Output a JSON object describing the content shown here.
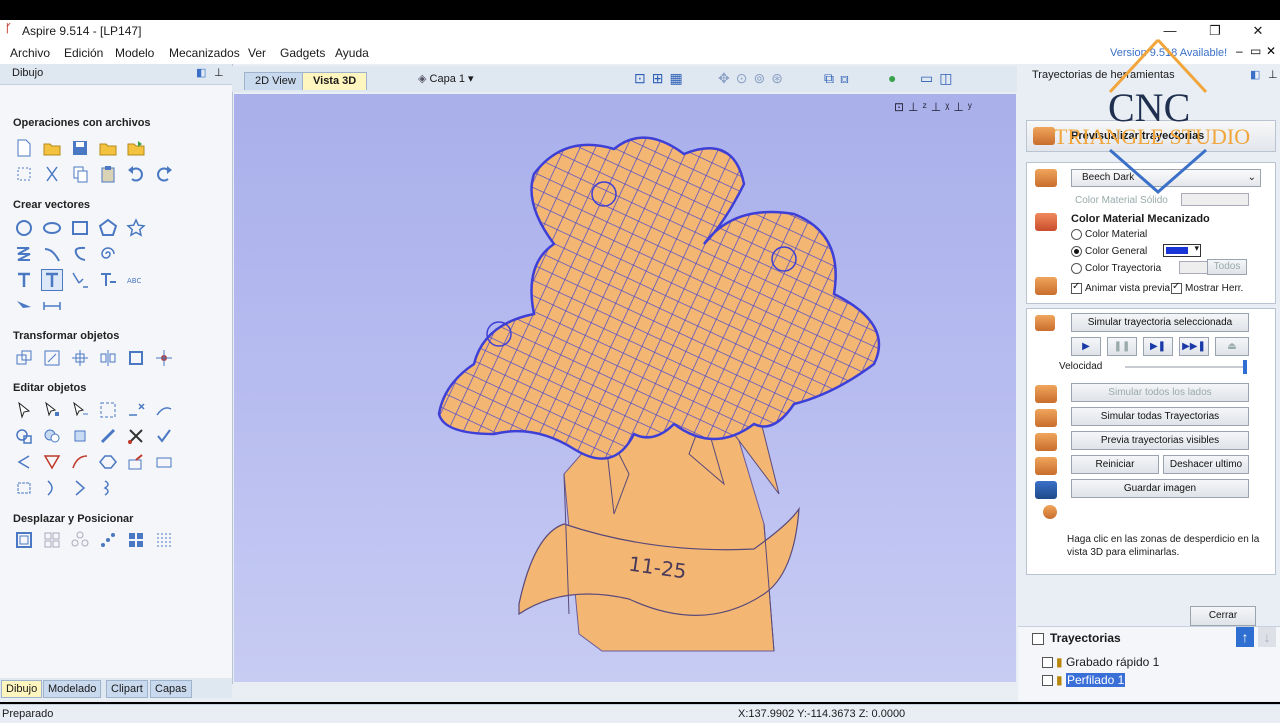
{
  "window": {
    "title": "Aspire 9.514 - [LP147]",
    "minimize": "—",
    "maximize": "❐",
    "close": "✕"
  },
  "menu": [
    "Archivo",
    "Edición",
    "Modelo",
    "Mecanizados",
    "Ver",
    "Gadgets",
    "Ayuda"
  ],
  "version_notice": "Version 9.518 Available!",
  "left_panel": {
    "title": "Dibujo",
    "sections": {
      "file_ops": "Operaciones con archivos",
      "create_vectors": "Crear vectores",
      "transform": "Transformar objetos",
      "edit": "Editar objetos",
      "move_position": "Desplazar y Posicionar"
    },
    "tabs": [
      "Dibujo",
      "Modelado",
      "Clipart",
      "Capas"
    ]
  },
  "view_tabs": {
    "tab_2d": "2D View",
    "tab_3d": "Vista 3D",
    "layer": "Capa 1"
  },
  "artwork": {
    "ribbon_text": "11-25"
  },
  "right_panel": {
    "title": "Trayectorias de herramientas",
    "preview_header": "Previsualizar trayectorias",
    "material": "Beech Dark",
    "color_material_solido": "Color Material Sólido",
    "color_material_mecanizado": "Color Material Mecanizado",
    "radio_color_material": "Color Material",
    "radio_color_general": "Color General",
    "radio_color_trayectoria": "Color Trayectoria",
    "btn_todos": "Todos",
    "chk_animar": "Animar vista previa",
    "chk_mostrar": "Mostrar Herr.",
    "btn_simular_sel": "Simular trayectoria seleccionada",
    "velocidad": "Velocidad",
    "btn_simular_lados": "Simular todos los lados",
    "btn_simular_todas": "Simular todas Trayectorias",
    "btn_previa": "Previa trayectorias visibles",
    "btn_reiniciar": "Reiniciar",
    "btn_deshacer": "Deshacer ultimo",
    "btn_guardar": "Guardar imagen",
    "hint": "Haga clic en las zonas de desperdicio en la vista 3D para eliminarlas.",
    "btn_cerrar": "Cerrar",
    "toolpaths_title": "Trayectorias",
    "toolpaths": [
      "Grabado rápido 1",
      "Perfilado 1"
    ]
  },
  "status": {
    "text": "Preparado",
    "coords": "X:137.9902 Y:-114.3673 Z:  0.0000"
  },
  "watermark": {
    "line1": "CNC",
    "line2": "TRIANGLE STUDIO"
  },
  "colors": {
    "accent": "#3a70c8",
    "selected": "#3a6fd8",
    "wood": "#f3b673",
    "mesh": "#3d3fd6"
  }
}
